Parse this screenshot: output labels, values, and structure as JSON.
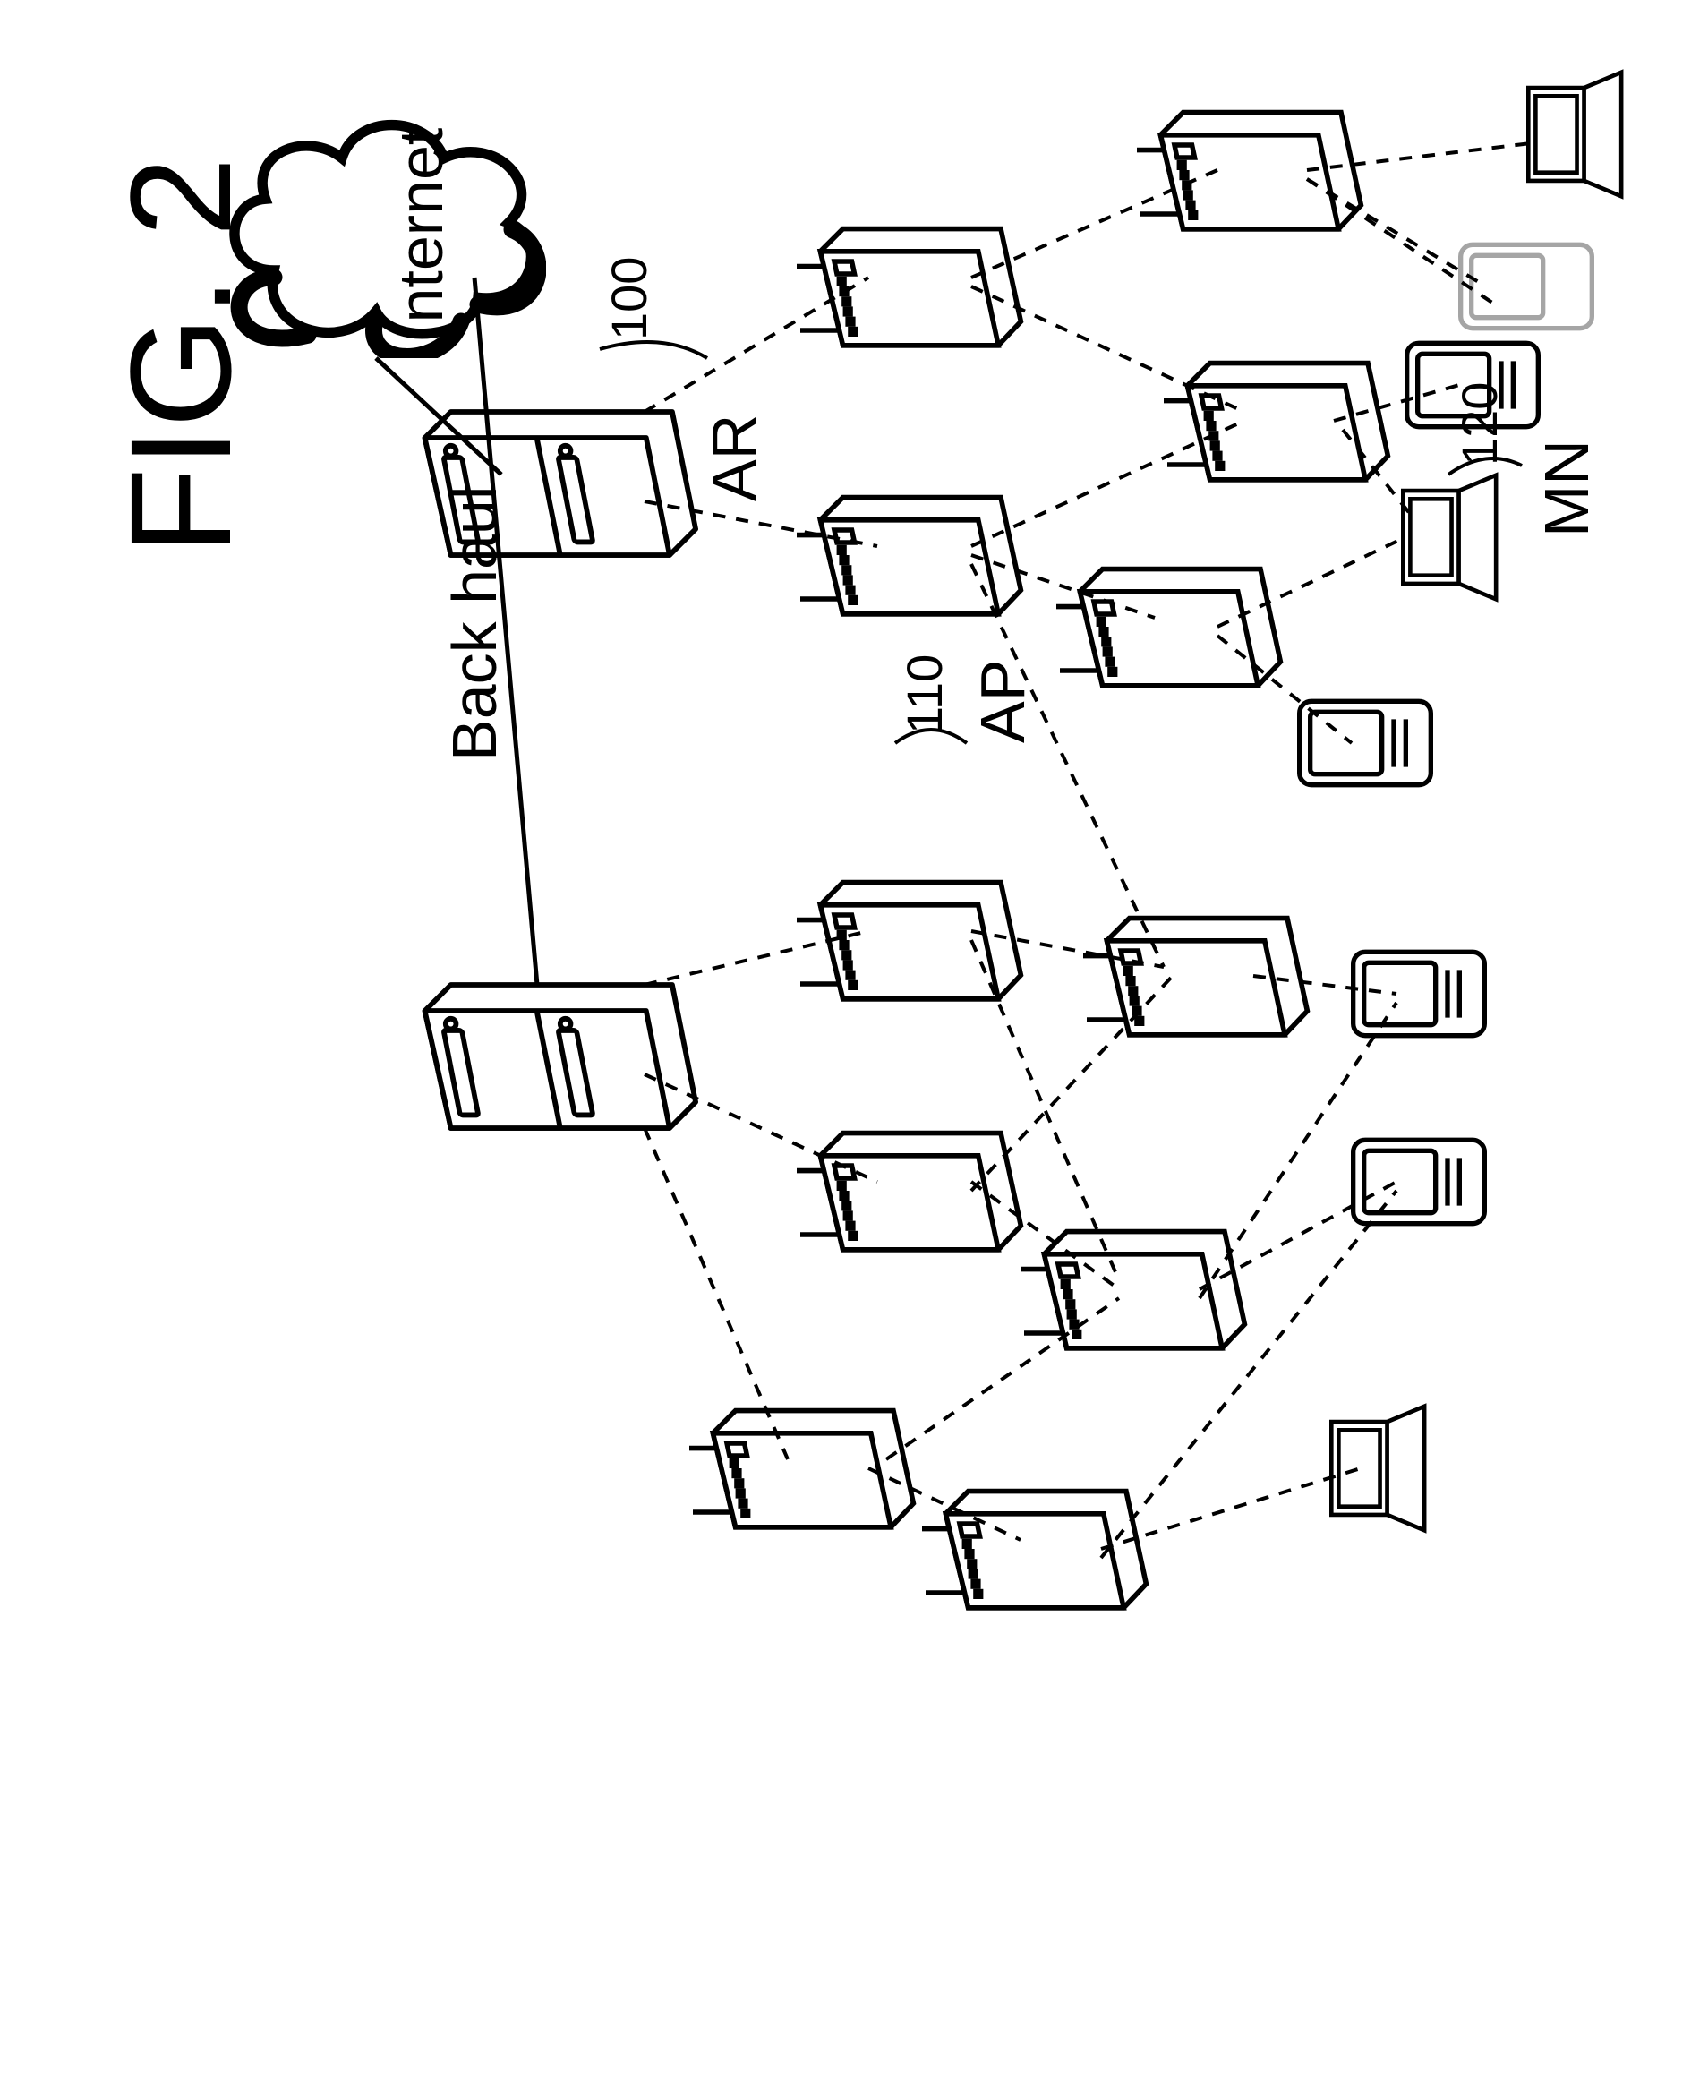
{
  "figure": {
    "title": "FIG. 2"
  },
  "labels": {
    "internet": "Internet",
    "backhaul": "Back haul",
    "ar": "AR",
    "ap": "AP",
    "mn": "MN",
    "n100": "100",
    "n110": "110",
    "n120": "120"
  },
  "topology": {
    "root": "Internet",
    "ar_count": 2,
    "ap_tiers": 2,
    "mn_types": [
      "laptop",
      "handheld"
    ],
    "link_types": {
      "wired_backhaul": "solid",
      "wireless_mesh_and_access": "dashed"
    },
    "ref_labels": {
      "AR": 100,
      "AP": 110,
      "MN": 120
    }
  }
}
